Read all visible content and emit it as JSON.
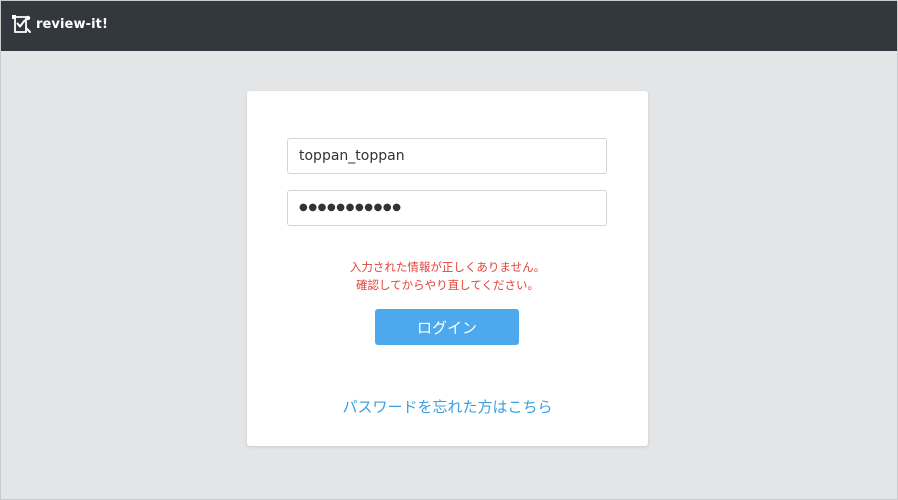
{
  "header": {
    "brand_name": "review-it!",
    "logo_icon": "review-it-logo-icon",
    "background_color": "#33373e"
  },
  "login_form": {
    "username_value": "toppan_toppan",
    "password_masked": "●●●●●●●●●●●",
    "error_line_1": "入力された情報が正しくありません。",
    "error_line_2": "確認してからやり直してください。",
    "error_color": "#e0453a",
    "login_button_label": "ログイン",
    "login_button_color": "#4ca9ee",
    "forgot_password_link": "パスワードを忘れた方はこちら",
    "link_color": "#3d9ee0"
  },
  "page": {
    "background_color": "#e4e5e7"
  }
}
